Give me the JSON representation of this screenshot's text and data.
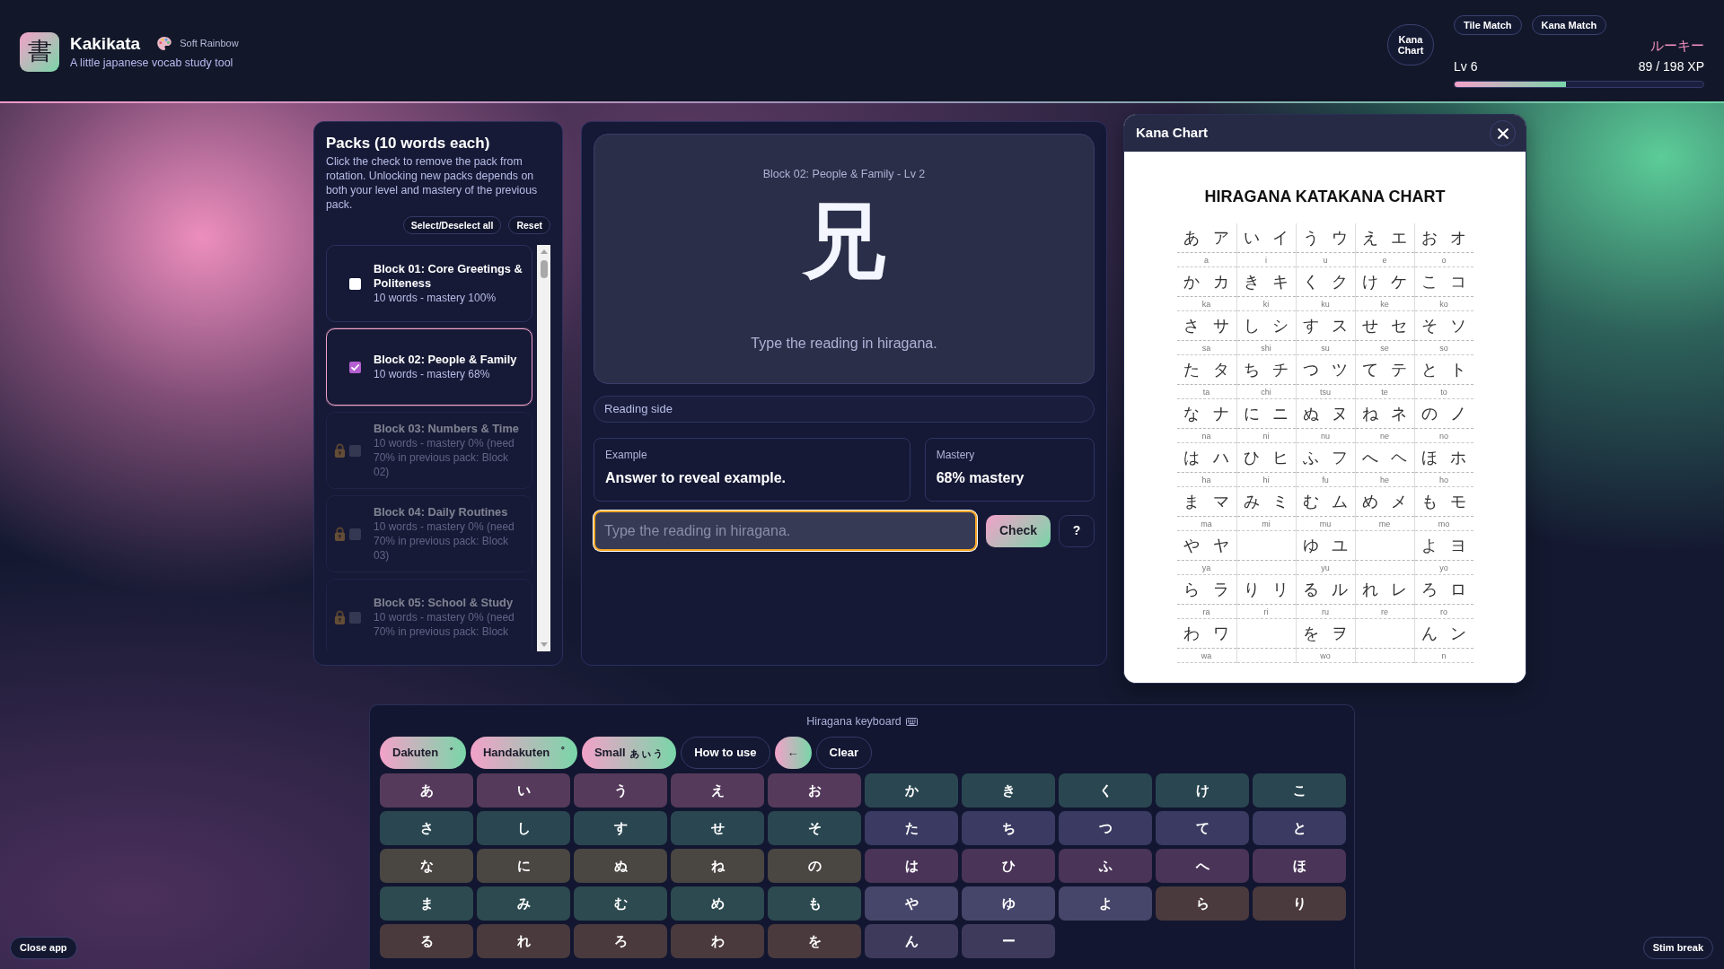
{
  "header": {
    "logo": "書",
    "title": "Kakikata",
    "theme": "Soft Rainbow",
    "subtitle": "A little japanese vocab study tool",
    "chart_button": "Kana Chart",
    "mode_buttons": [
      "Tile Match",
      "Kana Match"
    ],
    "rank": "ルーキー",
    "level_label": "Lv 6",
    "xp": "89 / 198 XP",
    "xp_bar": {
      "level": 0.449
    }
  },
  "packs": {
    "title": "Packs (10 words each)",
    "description": "Click the check to remove the pack from rotation. Unlocking new packs depends on both your level and mastery of the previous pack.",
    "actions": [
      "Select/Deselect all",
      "Reset"
    ],
    "items": [
      {
        "title": "Block 01: Core Greetings & Politeness",
        "detail": "10 words - mastery 100%",
        "checked": false,
        "selected": false,
        "locked": false
      },
      {
        "title": "Block 02: People & Family",
        "detail": "10 words - mastery 68%",
        "checked": true,
        "selected": true,
        "locked": false
      },
      {
        "title": "Block 03: Numbers & Time",
        "detail": "10 words - mastery 0% (need 70% in previous pack: Block 02)",
        "checked": false,
        "selected": false,
        "locked": true
      },
      {
        "title": "Block 04: Daily Routines",
        "detail": "10 words - mastery 0% (need 70% in previous pack: Block 03)",
        "checked": false,
        "selected": false,
        "locked": true
      },
      {
        "title": "Block 05: School & Study",
        "detail": "10 words - mastery 0% (need 70% in previous pack: Block",
        "checked": false,
        "selected": false,
        "locked": true
      }
    ]
  },
  "study": {
    "caption": "Block 02: People & Family - Lv 2",
    "kanji": "兄",
    "prompt": "Type the reading in hiragana.",
    "side": "Reading side",
    "example": {
      "label": "Example",
      "text": "Answer to reveal example."
    },
    "mastery": {
      "label": "Mastery",
      "text": "68% mastery"
    },
    "answer": {
      "placeholder": "Type the reading in hiragana.",
      "focused": true
    },
    "buttons": [
      {
        "label": "Check",
        "kind": "primary"
      },
      {
        "label": "?",
        "kind": "outline"
      }
    ]
  },
  "kana_chart": {
    "title": "Kana Chart",
    "chart_title": "HIRAGANA KATAKANA CHART",
    "rows": [
      {
        "cells": [
          {
            "kind": "kana",
            "hiragana": "あ",
            "katakana": "ア",
            "romaji": "a"
          },
          {
            "kind": "kana",
            "hiragana": "い",
            "katakana": "イ",
            "romaji": "i"
          },
          {
            "kind": "kana",
            "hiragana": "う",
            "katakana": "ウ",
            "romaji": "u"
          },
          {
            "kind": "kana",
            "hiragana": "え",
            "katakana": "エ",
            "romaji": "e"
          },
          {
            "kind": "kana",
            "hiragana": "お",
            "katakana": "オ",
            "romaji": "o"
          }
        ]
      },
      {
        "cells": [
          {
            "kind": "kana",
            "hiragana": "か",
            "katakana": "カ",
            "romaji": "ka"
          },
          {
            "kind": "kana",
            "hiragana": "き",
            "katakana": "キ",
            "romaji": "ki"
          },
          {
            "kind": "kana",
            "hiragana": "く",
            "katakana": "ク",
            "romaji": "ku"
          },
          {
            "kind": "kana",
            "hiragana": "け",
            "katakana": "ケ",
            "romaji": "ke"
          },
          {
            "kind": "kana",
            "hiragana": "こ",
            "katakana": "コ",
            "romaji": "ko"
          }
        ]
      },
      {
        "cells": [
          {
            "kind": "kana",
            "hiragana": "さ",
            "katakana": "サ",
            "romaji": "sa"
          },
          {
            "kind": "kana",
            "hiragana": "し",
            "katakana": "シ",
            "romaji": "shi"
          },
          {
            "kind": "kana",
            "hiragana": "す",
            "katakana": "ス",
            "romaji": "su"
          },
          {
            "kind": "kana",
            "hiragana": "せ",
            "katakana": "セ",
            "romaji": "se"
          },
          {
            "kind": "kana",
            "hiragana": "そ",
            "katakana": "ソ",
            "romaji": "so"
          }
        ]
      },
      {
        "cells": [
          {
            "kind": "kana",
            "hiragana": "た",
            "katakana": "タ",
            "romaji": "ta"
          },
          {
            "kind": "kana",
            "hiragana": "ち",
            "katakana": "チ",
            "romaji": "chi"
          },
          {
            "kind": "kana",
            "hiragana": "つ",
            "katakana": "ツ",
            "romaji": "tsu"
          },
          {
            "kind": "kana",
            "hiragana": "て",
            "katakana": "テ",
            "romaji": "te"
          },
          {
            "kind": "kana",
            "hiragana": "と",
            "katakana": "ト",
            "romaji": "to"
          }
        ]
      },
      {
        "cells": [
          {
            "kind": "kana",
            "hiragana": "な",
            "katakana": "ナ",
            "romaji": "na"
          },
          {
            "kind": "kana",
            "hiragana": "に",
            "katakana": "ニ",
            "romaji": "ni"
          },
          {
            "kind": "kana",
            "hiragana": "ぬ",
            "katakana": "ヌ",
            "romaji": "nu"
          },
          {
            "kind": "kana",
            "hiragana": "ね",
            "katakana": "ネ",
            "romaji": "ne"
          },
          {
            "kind": "kana",
            "hiragana": "の",
            "katakana": "ノ",
            "romaji": "no"
          }
        ]
      },
      {
        "cells": [
          {
            "kind": "kana",
            "hiragana": "は",
            "katakana": "ハ",
            "romaji": "ha"
          },
          {
            "kind": "kana",
            "hiragana": "ひ",
            "katakana": "ヒ",
            "romaji": "hi"
          },
          {
            "kind": "kana",
            "hiragana": "ふ",
            "katakana": "フ",
            "romaji": "fu"
          },
          {
            "kind": "kana",
            "hiragana": "へ",
            "katakana": "ヘ",
            "romaji": "he"
          },
          {
            "kind": "kana",
            "hiragana": "ほ",
            "katakana": "ホ",
            "romaji": "ho"
          }
        ]
      },
      {
        "cells": [
          {
            "kind": "kana",
            "hiragana": "ま",
            "katakana": "マ",
            "romaji": "ma"
          },
          {
            "kind": "kana",
            "hiragana": "み",
            "katakana": "ミ",
            "romaji": "mi"
          },
          {
            "kind": "kana",
            "hiragana": "む",
            "katakana": "ム",
            "romaji": "mu"
          },
          {
            "kind": "kana",
            "hiragana": "め",
            "katakana": "メ",
            "romaji": "me"
          },
          {
            "kind": "kana",
            "hiragana": "も",
            "katakana": "モ",
            "romaji": "mo"
          }
        ]
      },
      {
        "cells": [
          {
            "kind": "kana",
            "hiragana": "や",
            "katakana": "ヤ",
            "romaji": "ya"
          },
          {
            "kind": "blank"
          },
          {
            "kind": "kana",
            "hiragana": "ゆ",
            "katakana": "ユ",
            "romaji": "yu"
          },
          {
            "kind": "blank"
          },
          {
            "kind": "kana",
            "hiragana": "よ",
            "katakana": "ヨ",
            "romaji": "yo"
          }
        ]
      },
      {
        "cells": [
          {
            "kind": "kana",
            "hiragana": "ら",
            "katakana": "ラ",
            "romaji": "ra"
          },
          {
            "kind": "kana",
            "hiragana": "り",
            "katakana": "リ",
            "romaji": "ri"
          },
          {
            "kind": "kana",
            "hiragana": "る",
            "katakana": "ル",
            "romaji": "ru"
          },
          {
            "kind": "kana",
            "hiragana": "れ",
            "katakana": "レ",
            "romaji": "re"
          },
          {
            "kind": "kana",
            "hiragana": "ろ",
            "katakana": "ロ",
            "romaji": "ro"
          }
        ]
      },
      {
        "cells": [
          {
            "kind": "kana",
            "hiragana": "わ",
            "katakana": "ワ",
            "romaji": "wa"
          },
          {
            "kind": "blank"
          },
          {
            "kind": "kana",
            "hiragana": "を",
            "katakana": "ヲ",
            "romaji": "wo"
          },
          {
            "kind": "blank"
          },
          {
            "kind": "kana",
            "hiragana": "ん",
            "katakana": "ン",
            "romaji": "n"
          }
        ]
      }
    ]
  },
  "keyboard": {
    "title": "Hiragana keyboard",
    "controls": [
      {
        "label": "Dakuten ゛",
        "kind": "gradient"
      },
      {
        "label": "Handakuten ゜",
        "kind": "gradient"
      },
      {
        "label": "Small ぁぃぅ",
        "kind": "gradient"
      },
      {
        "label": "How to use",
        "kind": "outline"
      },
      {
        "label": "←",
        "kind": "gradient"
      },
      {
        "label": "Clear",
        "kind": "outline"
      }
    ],
    "keys": [
      {
        "label": "あ",
        "color": "#553a5c"
      },
      {
        "label": "い",
        "color": "#553a5c"
      },
      {
        "label": "う",
        "color": "#553a5c"
      },
      {
        "label": "え",
        "color": "#553a5c"
      },
      {
        "label": "お",
        "color": "#553a5c"
      },
      {
        "label": "か",
        "color": "#2a4751"
      },
      {
        "label": "き",
        "color": "#2a4751"
      },
      {
        "label": "く",
        "color": "#2a4751"
      },
      {
        "label": "け",
        "color": "#2a4751"
      },
      {
        "label": "こ",
        "color": "#2a4751"
      },
      {
        "label": "さ",
        "color": "#2a4751"
      },
      {
        "label": "し",
        "color": "#2a4751"
      },
      {
        "label": "す",
        "color": "#2a4751"
      },
      {
        "label": "せ",
        "color": "#2a4751"
      },
      {
        "label": "そ",
        "color": "#2a4751"
      },
      {
        "label": "た",
        "color": "#3a3a62"
      },
      {
        "label": "ち",
        "color": "#3a3a62"
      },
      {
        "label": "つ",
        "color": "#3a3a62"
      },
      {
        "label": "て",
        "color": "#3a3a62"
      },
      {
        "label": "と",
        "color": "#3a3a62"
      },
      {
        "label": "な",
        "color": "#4a4642"
      },
      {
        "label": "に",
        "color": "#4a4642"
      },
      {
        "label": "ぬ",
        "color": "#4a4642"
      },
      {
        "label": "ね",
        "color": "#4a4642"
      },
      {
        "label": "の",
        "color": "#4a4642"
      },
      {
        "label": "は",
        "color": "#4a3458"
      },
      {
        "label": "ひ",
        "color": "#4a3458"
      },
      {
        "label": "ふ",
        "color": "#4a3458"
      },
      {
        "label": "へ",
        "color": "#4a3458"
      },
      {
        "label": "ほ",
        "color": "#4a3458"
      },
      {
        "label": "ま",
        "color": "#2c4a50"
      },
      {
        "label": "み",
        "color": "#2c4a50"
      },
      {
        "label": "む",
        "color": "#2c4a50"
      },
      {
        "label": "め",
        "color": "#2c4a50"
      },
      {
        "label": "も",
        "color": "#2c4a50"
      },
      {
        "label": "や",
        "color": "#46456a"
      },
      {
        "label": "ゆ",
        "color": "#46456a"
      },
      {
        "label": "よ",
        "color": "#46456a"
      },
      {
        "label": "ら",
        "color": "#4a3a3e"
      },
      {
        "label": "り",
        "color": "#4a3a3e"
      },
      {
        "label": "る",
        "color": "#4a3a3e"
      },
      {
        "label": "れ",
        "color": "#4a3a3e"
      },
      {
        "label": "ろ",
        "color": "#4a3a3e"
      },
      {
        "label": "わ",
        "color": "#4a3a3e"
      },
      {
        "label": "を",
        "color": "#4a3a3e"
      },
      {
        "label": "ん",
        "color": "#3e3a5c"
      },
      {
        "label": "ー",
        "color": "#3e3a5c"
      }
    ]
  },
  "footer": {
    "left_button": "Close app",
    "right_button": "Stim break"
  }
}
